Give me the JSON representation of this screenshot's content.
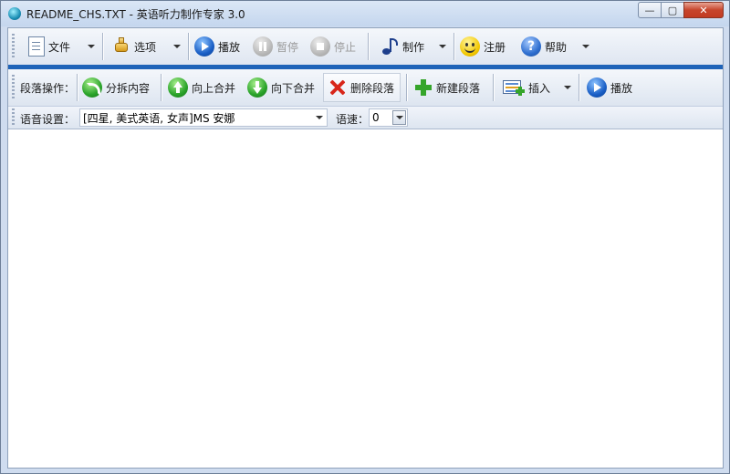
{
  "window": {
    "title": "README_CHS.TXT - 英语听力制作专家 3.0",
    "controls": {
      "minimize": "—",
      "maximize": "▢",
      "close": "✕"
    }
  },
  "main_toolbar": {
    "file": "文件",
    "options": "选项",
    "play": "播放",
    "pause": "暂停",
    "stop": "停止",
    "make": "制作",
    "register": "注册",
    "help": "帮助"
  },
  "paragraph_toolbar": {
    "label": "段落操作：",
    "split": "分拆内容",
    "merge_up": "向上合并",
    "merge_down": "向下合并",
    "delete": "删除段落",
    "new": "新建段落",
    "insert": "插入",
    "play": "播放"
  },
  "voice_toolbar": {
    "voice_label": "语音设置：",
    "voice_value": "[四星, 美式英语, 女声]MS 安娜",
    "speed_label": "语速：",
    "speed_value": "0"
  },
  "icons": {
    "file": "document-icon",
    "options": "gear-icon",
    "play": "play-icon",
    "pause": "pause-icon",
    "stop": "stop-icon",
    "make": "music-note-icon",
    "register": "smiley-icon",
    "help": "help-icon"
  }
}
